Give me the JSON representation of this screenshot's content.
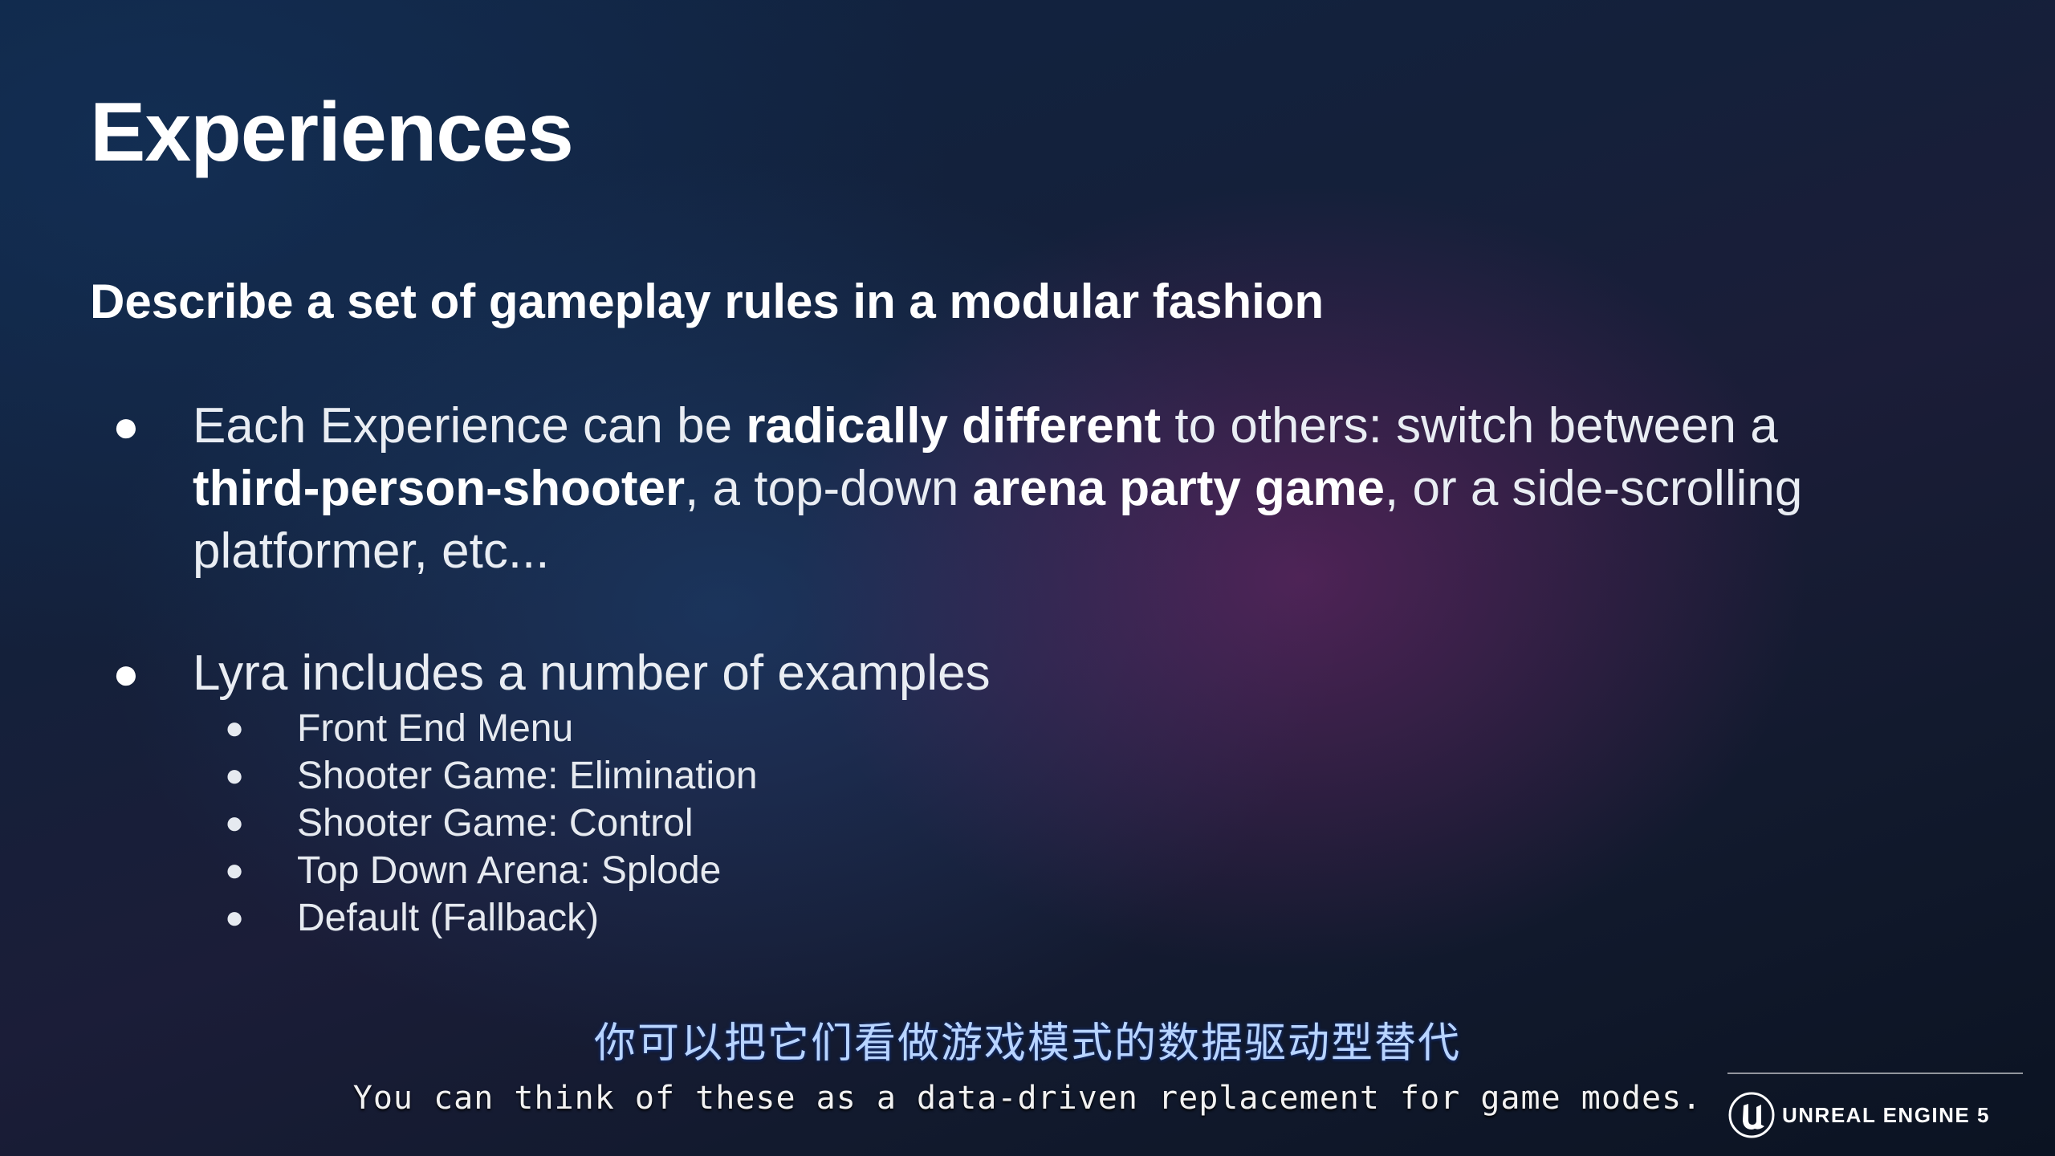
{
  "slide": {
    "title": "Experiences",
    "subtitle": "Describe a set of gameplay rules in a modular fashion",
    "bullet_1": {
      "t1": "Each Experience can be ",
      "b1": "radically different",
      "t2": " to others: switch between a ",
      "b2": "third-person-shooter",
      "t3": ", a top-down ",
      "b3": "arena party game",
      "t4": ", or a side-scrolling platformer, etc..."
    },
    "bullet_2": {
      "text": "Lyra includes a number of examples",
      "sub_items": [
        "Front End Menu",
        "Shooter Game: Elimination",
        "Shooter Game: Control",
        "Top Down Arena: Splode",
        "Default (Fallback)"
      ]
    },
    "bullet_glyph": "●"
  },
  "captions": {
    "zh": "你可以把它们看做游戏模式的数据驱动型替代",
    "en": "You can think of these as a data-driven replacement for game modes."
  },
  "brand": {
    "name": "UNREAL ENGINE 5",
    "icon": "unreal-engine-logo-icon"
  }
}
